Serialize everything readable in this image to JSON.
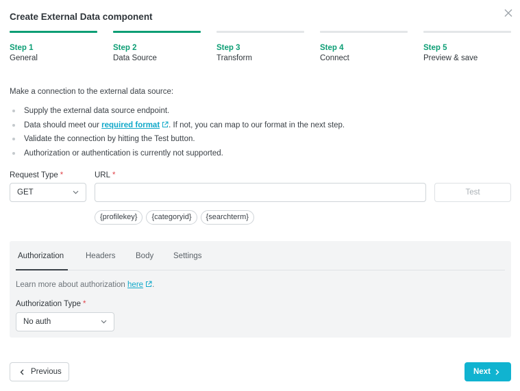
{
  "dialog": {
    "title": "Create External Data component"
  },
  "steps": [
    {
      "num": "Step 1",
      "name": "General",
      "state": "done"
    },
    {
      "num": "Step 2",
      "name": "Data Source",
      "state": "done"
    },
    {
      "num": "Step 3",
      "name": "Transform",
      "state": "pending"
    },
    {
      "num": "Step 4",
      "name": "Connect",
      "state": "pending"
    },
    {
      "num": "Step 5",
      "name": "Preview & save",
      "state": "pending"
    }
  ],
  "intro": "Make a connection to the external data source:",
  "bullets": {
    "b1": "Supply the external data source endpoint.",
    "b2_before": "Data should meet our ",
    "b2_link": "required format",
    "b2_after": ". If not, you can map to our format in the next step.",
    "b3": "Validate the connection by hitting the Test button.",
    "b4": "Authorization or authentication is currently not supported."
  },
  "request": {
    "type_label": "Request Type",
    "type_value": "GET",
    "url_label": "URL",
    "url_value": "",
    "required_mark": "*",
    "test_label": "Test"
  },
  "chips": [
    "{profilekey}",
    "{categoryid}",
    "{searchterm}"
  ],
  "panel": {
    "tabs": [
      "Authorization",
      "Headers",
      "Body",
      "Settings"
    ],
    "note_before": "Learn more about authorization ",
    "note_link": "here",
    "note_after": ".",
    "auth_type_label": "Authorization Type",
    "auth_type_value": "No auth"
  },
  "footer": {
    "previous_label": "Previous",
    "next_label": "Next"
  },
  "colors": {
    "accent_green": "#0d9e75",
    "primary_button": "#10b3d0",
    "link": "#10a8c9",
    "required": "#e0454b"
  }
}
